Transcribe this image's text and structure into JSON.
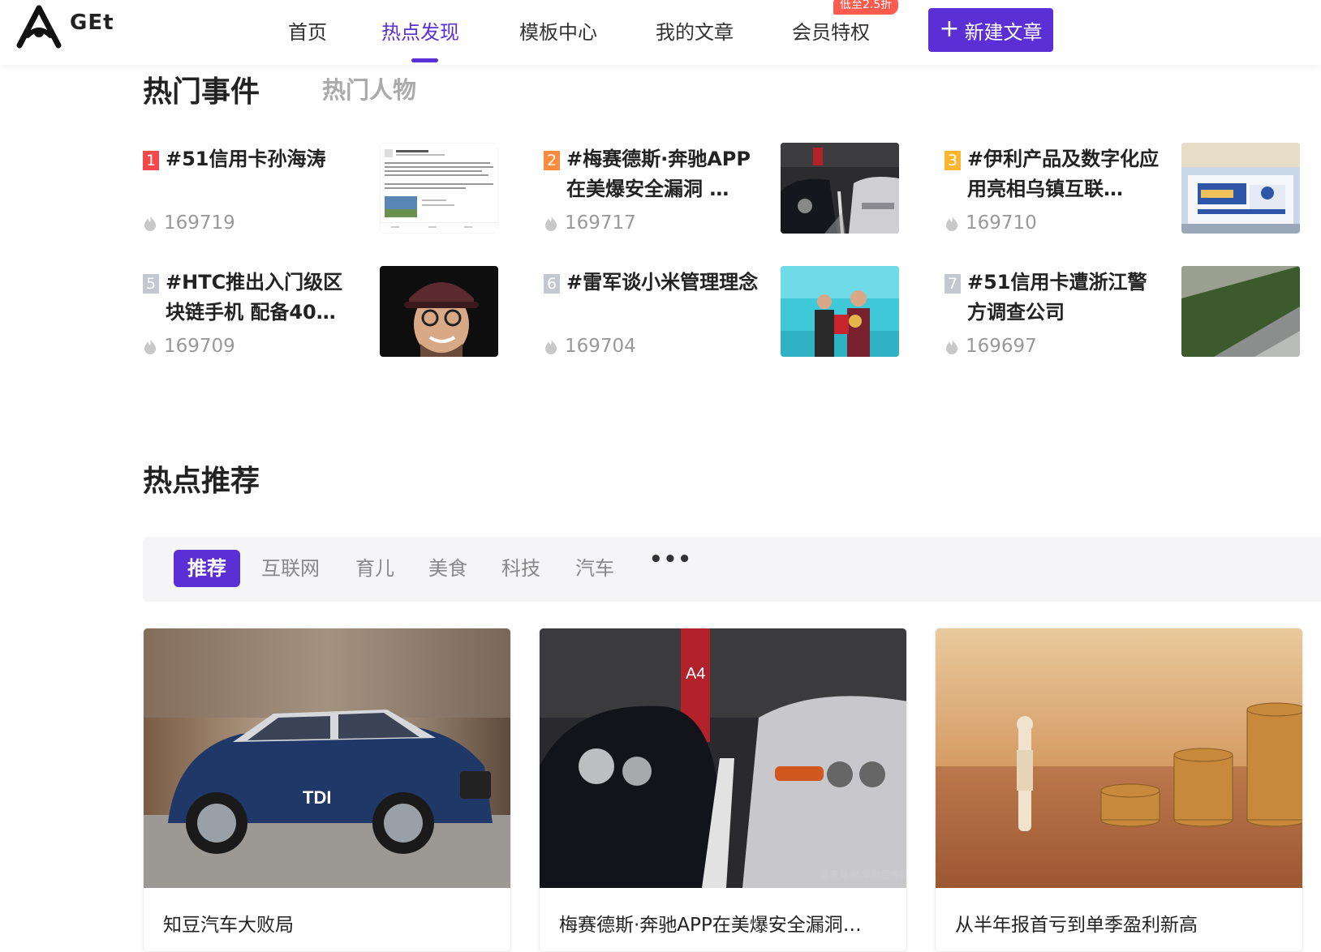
{
  "app": {
    "logo_text": "GEt"
  },
  "nav": {
    "items": [
      {
        "label": "首页"
      },
      {
        "label": "热点发现"
      },
      {
        "label": "模板中心"
      },
      {
        "label": "我的文章"
      },
      {
        "label": "会员特权"
      }
    ],
    "promo_badge": "低至2.5折",
    "new_button": "新建文章",
    "accent_color": "#5b2fd6"
  },
  "hot": {
    "tabs": [
      {
        "label": "热门事件"
      },
      {
        "label": "热门人物"
      }
    ],
    "events": [
      {
        "rank": "1",
        "title": "#51信用卡孙海涛",
        "heat": "169719",
        "rank_color": "#f5484a",
        "thumb": "weibo-screenshot"
      },
      {
        "rank": "2",
        "title": "#梅赛德斯·奔驰APP在美爆安全漏洞 …",
        "heat": "169717",
        "rank_color": "#ff8a3d",
        "thumb": "parked-cars"
      },
      {
        "rank": "3",
        "title": "#伊利产品及数字化应用亮相乌镇互联…",
        "heat": "169710",
        "rank_color": "#ffb52e",
        "thumb": "internet-conference"
      },
      {
        "rank": "5",
        "title": "#HTC推出入门级区块链手机 配备40…",
        "heat": "169709",
        "rank_color": "#c3c7d0",
        "thumb": "man-portrait"
      },
      {
        "rank": "6",
        "title": "#雷军谈小米管理理念",
        "heat": "169704",
        "rank_color": "#c3c7d0",
        "thumb": "award-ceremony"
      },
      {
        "rank": "7",
        "title": "#51信用卡遭浙江警方调查公司",
        "heat": "169697",
        "rank_color": "#c3c7d0",
        "thumb": "building-hedge"
      }
    ]
  },
  "recommend": {
    "title": "热点推荐",
    "filters": [
      {
        "label": "推荐"
      },
      {
        "label": "互联网"
      },
      {
        "label": "育儿"
      },
      {
        "label": "美食"
      },
      {
        "label": "科技"
      },
      {
        "label": "汽车"
      }
    ],
    "more": "•••",
    "cards": [
      {
        "title": "知豆汽车大败局",
        "image": "blue-suv-tdi",
        "image_text": "TDI"
      },
      {
        "title": "梅赛德斯·奔驰APP在美爆安全漏洞…",
        "image": "parked-cars",
        "image_text": "百家号/新华财经传媒"
      },
      {
        "title": "从半年报首亏到单季盈利新高",
        "image": "figurine-coins"
      }
    ]
  }
}
